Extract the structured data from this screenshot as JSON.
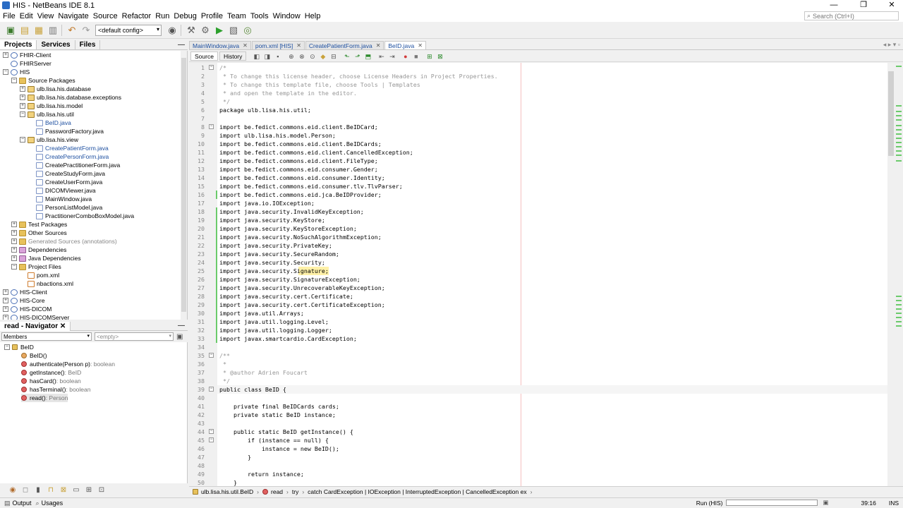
{
  "window": {
    "title": "HIS - NetBeans IDE 8.1",
    "controls": [
      "—",
      "❐",
      "✕"
    ]
  },
  "menu": [
    "File",
    "Edit",
    "View",
    "Navigate",
    "Source",
    "Refactor",
    "Run",
    "Debug",
    "Profile",
    "Team",
    "Tools",
    "Window",
    "Help"
  ],
  "search": {
    "placeholder": "Search (Ctrl+I)"
  },
  "toolbar": {
    "config": "<default config>"
  },
  "projects_panel": {
    "tabs": [
      "Projects",
      "Services",
      "Files"
    ],
    "min": "—"
  },
  "tree": [
    {
      "label": "FHIR-Client",
      "d": 0,
      "exp": "+",
      "ico": "proj"
    },
    {
      "label": "FHIRServer",
      "d": 0,
      "exp": "",
      "ico": "proj"
    },
    {
      "label": "HIS",
      "d": 0,
      "exp": "−",
      "ico": "proj"
    },
    {
      "label": "Source Packages",
      "d": 1,
      "exp": "−",
      "ico": "folder"
    },
    {
      "label": "ulb.lisa.his.database",
      "d": 2,
      "exp": "+",
      "ico": "pkg"
    },
    {
      "label": "ulb.lisa.his.database.exceptions",
      "d": 2,
      "exp": "+",
      "ico": "pkg"
    },
    {
      "label": "ulb.lisa.his.model",
      "d": 2,
      "exp": "+",
      "ico": "pkg"
    },
    {
      "label": "ulb.lisa.his.util",
      "d": 2,
      "exp": "−",
      "ico": "pkg"
    },
    {
      "label": "BeID.java",
      "d": 3,
      "exp": "",
      "ico": "file",
      "cls": "blue"
    },
    {
      "label": "PasswordFactory.java",
      "d": 3,
      "exp": "",
      "ico": "file"
    },
    {
      "label": "ulb.lisa.his.view",
      "d": 2,
      "exp": "−",
      "ico": "pkg"
    },
    {
      "label": "CreatePatientForm.java",
      "d": 3,
      "exp": "",
      "ico": "file",
      "cls": "blue"
    },
    {
      "label": "CreatePersonForm.java",
      "d": 3,
      "exp": "",
      "ico": "file",
      "cls": "blue"
    },
    {
      "label": "CreatePractitionerForm.java",
      "d": 3,
      "exp": "",
      "ico": "file"
    },
    {
      "label": "CreateStudyForm.java",
      "d": 3,
      "exp": "",
      "ico": "file"
    },
    {
      "label": "CreateUserForm.java",
      "d": 3,
      "exp": "",
      "ico": "file"
    },
    {
      "label": "DICOMViewer.java",
      "d": 3,
      "exp": "",
      "ico": "file"
    },
    {
      "label": "MainWindow.java",
      "d": 3,
      "exp": "",
      "ico": "file"
    },
    {
      "label": "PersonListModel.java",
      "d": 3,
      "exp": "",
      "ico": "file"
    },
    {
      "label": "PractitionerComboBoxModel.java",
      "d": 3,
      "exp": "",
      "ico": "file"
    },
    {
      "label": "Test Packages",
      "d": 1,
      "exp": "+",
      "ico": "folder"
    },
    {
      "label": "Other Sources",
      "d": 1,
      "exp": "+",
      "ico": "folder"
    },
    {
      "label": "Generated Sources (annotations)",
      "d": 1,
      "exp": "+",
      "ico": "folder",
      "cls": "grey"
    },
    {
      "label": "Dependencies",
      "d": 1,
      "exp": "+",
      "ico": "lib"
    },
    {
      "label": "Java Dependencies",
      "d": 1,
      "exp": "+",
      "ico": "lib"
    },
    {
      "label": "Project Files",
      "d": 1,
      "exp": "−",
      "ico": "folder"
    },
    {
      "label": "pom.xml",
      "d": 2,
      "exp": "",
      "ico": "xml"
    },
    {
      "label": "nbactions.xml",
      "d": 2,
      "exp": "",
      "ico": "xml"
    },
    {
      "label": "HIS-Client",
      "d": 0,
      "exp": "+",
      "ico": "proj"
    },
    {
      "label": "HIS-Core",
      "d": 0,
      "exp": "+",
      "ico": "proj"
    },
    {
      "label": "HIS-DICOM",
      "d": 0,
      "exp": "+",
      "ico": "proj"
    },
    {
      "label": "HIS-DICOMServer",
      "d": 0,
      "exp": "+",
      "ico": "proj"
    }
  ],
  "navigator": {
    "title": "read - Navigator",
    "filter": "Members",
    "empty": "<empty>",
    "root": "BeID",
    "members": [
      {
        "name": "BeID()",
        "ret": "",
        "ico": "ctor"
      },
      {
        "name": "authenticate(Person p)",
        "ret": " : boolean",
        "ico": "m"
      },
      {
        "name": "getInstance()",
        "ret": " : BeID",
        "ico": "m"
      },
      {
        "name": "hasCard()",
        "ret": " : boolean",
        "ico": "m"
      },
      {
        "name": "hasTerminal()",
        "ret": " : boolean",
        "ico": "m"
      },
      {
        "name": "read()",
        "ret": " : Person",
        "ico": "m"
      }
    ]
  },
  "editor": {
    "tabs": [
      "MainWindow.java",
      "pom.xml [HIS]",
      "CreatePatientForm.java",
      "BeID.java"
    ],
    "active": 3,
    "src_tabs": [
      "Source",
      "History"
    ],
    "lines": [
      {
        "n": 1,
        "t": "/*",
        "c": "cmt"
      },
      {
        "n": 2,
        "t": " * To change this license header, choose License Headers in Project Properties.",
        "c": "cmt"
      },
      {
        "n": 3,
        "t": " * To change this template file, choose Tools | Templates",
        "c": "cmt"
      },
      {
        "n": 4,
        "t": " * and open the template in the editor.",
        "c": "cmt"
      },
      {
        "n": 5,
        "t": " */",
        "c": "cmt"
      },
      {
        "n": 6,
        "t": "package ulb.lisa.his.util;",
        "c": ""
      },
      {
        "n": 7,
        "t": "",
        "c": ""
      },
      {
        "n": 8,
        "t": "import be.fedict.commons.eid.client.BeIDCard;",
        "c": ""
      },
      {
        "n": 9,
        "t": "import ulb.lisa.his.model.Person;",
        "c": ""
      },
      {
        "n": 10,
        "t": "import be.fedict.commons.eid.client.BeIDCards;",
        "c": ""
      },
      {
        "n": 11,
        "t": "import be.fedict.commons.eid.client.CancelledException;",
        "c": ""
      },
      {
        "n": 12,
        "t": "import be.fedict.commons.eid.client.FileType;",
        "c": ""
      },
      {
        "n": 13,
        "t": "import be.fedict.commons.eid.consumer.Gender;",
        "c": ""
      },
      {
        "n": 14,
        "t": "import be.fedict.commons.eid.consumer.Identity;",
        "c": ""
      },
      {
        "n": 15,
        "t": "import be.fedict.commons.eid.consumer.tlv.TlvParser;",
        "c": ""
      },
      {
        "n": 16,
        "t": "import be.fedict.commons.eid.jca.BeIDProvider;",
        "c": ""
      },
      {
        "n": 17,
        "t": "import java.io.IOException;",
        "c": ""
      },
      {
        "n": 18,
        "t": "import java.security.InvalidKeyException;",
        "c": ""
      },
      {
        "n": 19,
        "t": "import java.security.KeyStore;",
        "c": ""
      },
      {
        "n": 20,
        "t": "import java.security.KeyStoreException;",
        "c": ""
      },
      {
        "n": 21,
        "t": "import java.security.NoSuchAlgorithmException;",
        "c": ""
      },
      {
        "n": 22,
        "t": "import java.security.PrivateKey;",
        "c": ""
      },
      {
        "n": 23,
        "t": "import java.security.SecureRandom;",
        "c": ""
      },
      {
        "n": 24,
        "t": "import java.security.Security;",
        "c": ""
      },
      {
        "n": 25,
        "t": "import java.security.Signature;",
        "c": "hl"
      },
      {
        "n": 26,
        "t": "import java.security.SignatureException;",
        "c": ""
      },
      {
        "n": 27,
        "t": "import java.security.UnrecoverableKeyException;",
        "c": ""
      },
      {
        "n": 28,
        "t": "import java.security.cert.Certificate;",
        "c": ""
      },
      {
        "n": 29,
        "t": "import java.security.cert.CertificateException;",
        "c": ""
      },
      {
        "n": 30,
        "t": "import java.util.Arrays;",
        "c": ""
      },
      {
        "n": 31,
        "t": "import java.util.logging.Level;",
        "c": ""
      },
      {
        "n": 32,
        "t": "import java.util.logging.Logger;",
        "c": ""
      },
      {
        "n": 33,
        "t": "import javax.smartcardio.CardException;",
        "c": ""
      },
      {
        "n": 34,
        "t": "",
        "c": ""
      },
      {
        "n": 35,
        "t": "/**",
        "c": "cmt"
      },
      {
        "n": 36,
        "t": " *",
        "c": "cmt"
      },
      {
        "n": 37,
        "t": " * @author Adrien Foucart",
        "c": "cmt"
      },
      {
        "n": 38,
        "t": " */",
        "c": "cmt"
      },
      {
        "n": 39,
        "t": "public class BeID {",
        "c": "cur"
      },
      {
        "n": 40,
        "t": "",
        "c": ""
      },
      {
        "n": 41,
        "t": "    private final BeIDCards cards;",
        "c": ""
      },
      {
        "n": 42,
        "t": "    private static BeID instance;",
        "c": ""
      },
      {
        "n": 43,
        "t": "",
        "c": ""
      },
      {
        "n": 44,
        "t": "    public static BeID getInstance() {",
        "c": ""
      },
      {
        "n": 45,
        "t": "        if (instance == null) {",
        "c": ""
      },
      {
        "n": 46,
        "t": "            instance = new BeID();",
        "c": ""
      },
      {
        "n": 47,
        "t": "        }",
        "c": ""
      },
      {
        "n": 48,
        "t": "",
        "c": ""
      },
      {
        "n": 49,
        "t": "        return instance;",
        "c": ""
      },
      {
        "n": 50,
        "t": "    }",
        "c": ""
      }
    ]
  },
  "breadcrumb": [
    "ulb.lisa.his.util.BeID",
    "read",
    "try",
    "catch CardException | IOException | InterruptedException | CancelledException ex"
  ],
  "bottom": {
    "output": "Output",
    "usages": "Usages",
    "run": "Run (HIS)",
    "pos": "39:16",
    "ins": "INS"
  }
}
